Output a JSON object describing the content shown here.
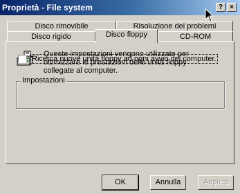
{
  "window": {
    "title": "Proprietà - File system",
    "help_button": "?",
    "close_button": "×"
  },
  "tabs": {
    "back_row": [
      "Disco rimovibile",
      "Risoluzione dei problemi"
    ],
    "front_row": [
      "Disco rigido",
      "Disco floppy",
      "CD-ROM"
    ],
    "active": "Disco floppy"
  },
  "panel": {
    "icon": "floppy-drive-icon",
    "description": "Queste impostazioni vengono utilizzate per ottimizzare le prestazioni delle unità floppy collegate al computer.",
    "group_label": "Impostazioni",
    "checkbox_label": "Ricerca nuove unità floppy ad ogni avvio del computer.",
    "checkbox_checked": false
  },
  "buttons": {
    "ok": "OK",
    "cancel": "Annulla",
    "apply": "Applica"
  },
  "colors": {
    "titlebar_start": "#0a246a",
    "titlebar_end": "#a6caf0",
    "face": "#d4d0c8"
  }
}
